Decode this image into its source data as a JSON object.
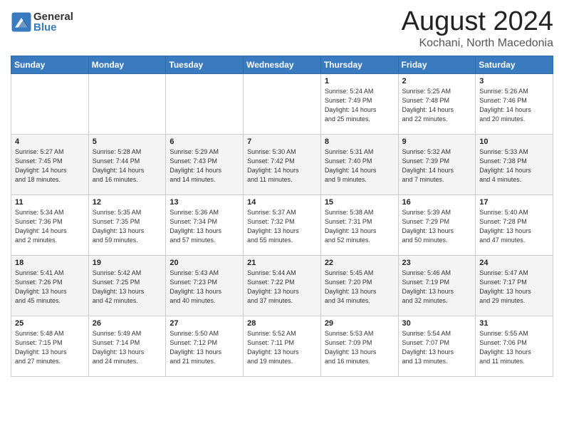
{
  "logo": {
    "general": "General",
    "blue": "Blue"
  },
  "title": "August 2024",
  "subtitle": "Kochani, North Macedonia",
  "days_of_week": [
    "Sunday",
    "Monday",
    "Tuesday",
    "Wednesday",
    "Thursday",
    "Friday",
    "Saturday"
  ],
  "weeks": [
    [
      {
        "day": "",
        "info": ""
      },
      {
        "day": "",
        "info": ""
      },
      {
        "day": "",
        "info": ""
      },
      {
        "day": "",
        "info": ""
      },
      {
        "day": "1",
        "info": "Sunrise: 5:24 AM\nSunset: 7:49 PM\nDaylight: 14 hours\nand 25 minutes."
      },
      {
        "day": "2",
        "info": "Sunrise: 5:25 AM\nSunset: 7:48 PM\nDaylight: 14 hours\nand 22 minutes."
      },
      {
        "day": "3",
        "info": "Sunrise: 5:26 AM\nSunset: 7:46 PM\nDaylight: 14 hours\nand 20 minutes."
      }
    ],
    [
      {
        "day": "4",
        "info": "Sunrise: 5:27 AM\nSunset: 7:45 PM\nDaylight: 14 hours\nand 18 minutes."
      },
      {
        "day": "5",
        "info": "Sunrise: 5:28 AM\nSunset: 7:44 PM\nDaylight: 14 hours\nand 16 minutes."
      },
      {
        "day": "6",
        "info": "Sunrise: 5:29 AM\nSunset: 7:43 PM\nDaylight: 14 hours\nand 14 minutes."
      },
      {
        "day": "7",
        "info": "Sunrise: 5:30 AM\nSunset: 7:42 PM\nDaylight: 14 hours\nand 11 minutes."
      },
      {
        "day": "8",
        "info": "Sunrise: 5:31 AM\nSunset: 7:40 PM\nDaylight: 14 hours\nand 9 minutes."
      },
      {
        "day": "9",
        "info": "Sunrise: 5:32 AM\nSunset: 7:39 PM\nDaylight: 14 hours\nand 7 minutes."
      },
      {
        "day": "10",
        "info": "Sunrise: 5:33 AM\nSunset: 7:38 PM\nDaylight: 14 hours\nand 4 minutes."
      }
    ],
    [
      {
        "day": "11",
        "info": "Sunrise: 5:34 AM\nSunset: 7:36 PM\nDaylight: 14 hours\nand 2 minutes."
      },
      {
        "day": "12",
        "info": "Sunrise: 5:35 AM\nSunset: 7:35 PM\nDaylight: 13 hours\nand 59 minutes."
      },
      {
        "day": "13",
        "info": "Sunrise: 5:36 AM\nSunset: 7:34 PM\nDaylight: 13 hours\nand 57 minutes."
      },
      {
        "day": "14",
        "info": "Sunrise: 5:37 AM\nSunset: 7:32 PM\nDaylight: 13 hours\nand 55 minutes."
      },
      {
        "day": "15",
        "info": "Sunrise: 5:38 AM\nSunset: 7:31 PM\nDaylight: 13 hours\nand 52 minutes."
      },
      {
        "day": "16",
        "info": "Sunrise: 5:39 AM\nSunset: 7:29 PM\nDaylight: 13 hours\nand 50 minutes."
      },
      {
        "day": "17",
        "info": "Sunrise: 5:40 AM\nSunset: 7:28 PM\nDaylight: 13 hours\nand 47 minutes."
      }
    ],
    [
      {
        "day": "18",
        "info": "Sunrise: 5:41 AM\nSunset: 7:26 PM\nDaylight: 13 hours\nand 45 minutes."
      },
      {
        "day": "19",
        "info": "Sunrise: 5:42 AM\nSunset: 7:25 PM\nDaylight: 13 hours\nand 42 minutes."
      },
      {
        "day": "20",
        "info": "Sunrise: 5:43 AM\nSunset: 7:23 PM\nDaylight: 13 hours\nand 40 minutes."
      },
      {
        "day": "21",
        "info": "Sunrise: 5:44 AM\nSunset: 7:22 PM\nDaylight: 13 hours\nand 37 minutes."
      },
      {
        "day": "22",
        "info": "Sunrise: 5:45 AM\nSunset: 7:20 PM\nDaylight: 13 hours\nand 34 minutes."
      },
      {
        "day": "23",
        "info": "Sunrise: 5:46 AM\nSunset: 7:19 PM\nDaylight: 13 hours\nand 32 minutes."
      },
      {
        "day": "24",
        "info": "Sunrise: 5:47 AM\nSunset: 7:17 PM\nDaylight: 13 hours\nand 29 minutes."
      }
    ],
    [
      {
        "day": "25",
        "info": "Sunrise: 5:48 AM\nSunset: 7:15 PM\nDaylight: 13 hours\nand 27 minutes."
      },
      {
        "day": "26",
        "info": "Sunrise: 5:49 AM\nSunset: 7:14 PM\nDaylight: 13 hours\nand 24 minutes."
      },
      {
        "day": "27",
        "info": "Sunrise: 5:50 AM\nSunset: 7:12 PM\nDaylight: 13 hours\nand 21 minutes."
      },
      {
        "day": "28",
        "info": "Sunrise: 5:52 AM\nSunset: 7:11 PM\nDaylight: 13 hours\nand 19 minutes."
      },
      {
        "day": "29",
        "info": "Sunrise: 5:53 AM\nSunset: 7:09 PM\nDaylight: 13 hours\nand 16 minutes."
      },
      {
        "day": "30",
        "info": "Sunrise: 5:54 AM\nSunset: 7:07 PM\nDaylight: 13 hours\nand 13 minutes."
      },
      {
        "day": "31",
        "info": "Sunrise: 5:55 AM\nSunset: 7:06 PM\nDaylight: 13 hours\nand 11 minutes."
      }
    ]
  ]
}
